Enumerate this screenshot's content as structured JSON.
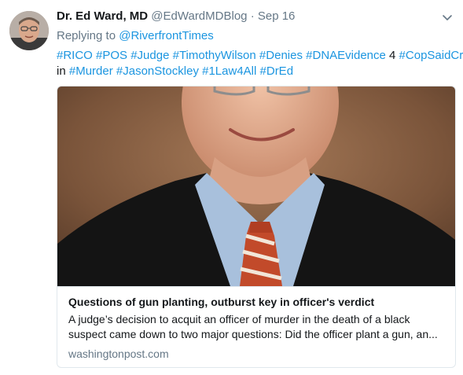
{
  "author": {
    "display_name": "Dr. Ed Ward, MD",
    "handle": "@EdWardMDBlog",
    "separator": "·",
    "time": "Sep 16"
  },
  "reply": {
    "prefix": "Replying to",
    "target": "@RiverfrontTimes"
  },
  "tweet": {
    "line1": [
      {
        "text": "#RICO",
        "type": "hashtag"
      },
      {
        "text": "#POS",
        "type": "hashtag"
      },
      {
        "text": "#Judge",
        "type": "hashtag"
      },
      {
        "text": "#TimothyWilson",
        "type": "hashtag"
      },
      {
        "text": "#Denies",
        "type": "hashtag"
      },
      {
        "text": "#DNAEvidence",
        "type": "hashtag"
      },
      {
        "text": "4",
        "type": "text"
      },
      {
        "text": "#CopSaidCrap",
        "type": "hashtag"
      }
    ],
    "line2": [
      {
        "text": "in",
        "type": "text"
      },
      {
        "text": "#Murder",
        "type": "hashtag"
      },
      {
        "text": "#JasonStockley",
        "type": "hashtag"
      },
      {
        "text": "#1Law4All",
        "type": "hashtag"
      },
      {
        "text": "#DrEd",
        "type": "hashtag"
      }
    ]
  },
  "card": {
    "title": "Questions of gun planting, outburst key in officer's verdict",
    "description_line1": "A judge’s decision to acquit an officer of murder in the death of a black",
    "description_line2": "suspect came down to two major questions: Did the officer plant a gun, an...",
    "domain": "washingtonpost.com"
  },
  "icons": {
    "caret": "chevron-down-icon"
  },
  "colors": {
    "link": "#1b95e0",
    "secondary_text": "#657786",
    "primary_text": "#14171a",
    "border": "#e1e8ed"
  }
}
